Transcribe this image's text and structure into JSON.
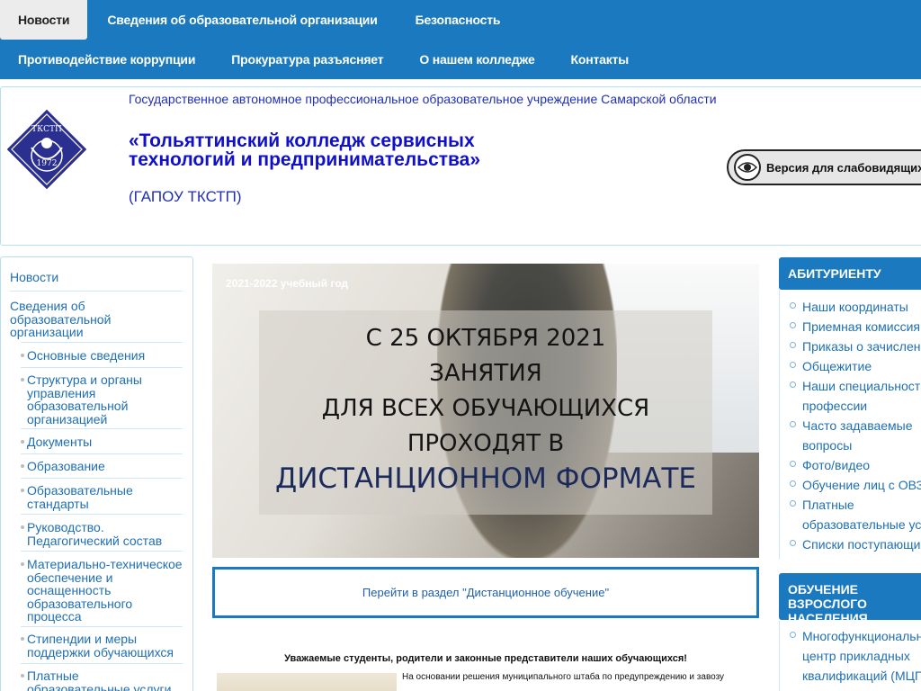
{
  "nav": {
    "row1": [
      "Новости",
      "Сведения об образовательной организации",
      "Безопасность"
    ],
    "row2": [
      "Противодействие коррупции",
      "Прокуратура разъясняет",
      "О нашем колледже",
      "Контакты"
    ]
  },
  "header": {
    "subtitle": "Государственное автономное профессиональное образовательное учреждение Самарской области",
    "title_line1": "«Тольяттинский колледж сервисных",
    "title_line2": "технологий и предпринимательства»",
    "abbr": "(ГАПОУ ТКСТП)",
    "logo_text_top": "ТКСТП",
    "logo_text_bottom": "1972",
    "vi_button": "Версия для слабовидящих"
  },
  "left_menu": {
    "news": "Новости",
    "org_info": "Сведения об образовательной организации",
    "subitems": [
      "Основные сведения",
      "Структура и органы управления образовательной организацией",
      "Документы",
      "Образование",
      "Образовательные стандарты",
      "Руководство. Педагогический состав",
      "Материально-техническое обеспечение и оснащенность образовательного процесса",
      "Стипендии и меры поддержки обучающихся",
      "Платные образовательные услуги"
    ]
  },
  "banner": {
    "year": "2021-2022 учебный год",
    "line1": "С 25 ОКТЯБРЯ 2021",
    "line2": "ЗАНЯТИЯ",
    "line3": "ДЛЯ ВСЕХ ОБУЧАЮЩИХСЯ",
    "line4": "ПРОХОДЯТ В",
    "line5": "ДИСТАНЦИОННОМ ФОРМАТЕ"
  },
  "distance_link": "Перейти в раздел \"Дистанционное обучение\"",
  "notice": {
    "heading": "Уважаемые студенты, родители и законные представители наших обучающихся!",
    "body": "На основании решения муниципального штаба по предупреждению и завозу"
  },
  "right": {
    "abit_title": "АБИТУРИЕНТУ",
    "abit_items": [
      "Наши координаты",
      "Приемная комиссия",
      "Приказы о зачислении",
      "Общежитие",
      "Наши специальности,",
      "профессии",
      "Часто задаваемые",
      "вопросы",
      "Фото/видео",
      "Обучение лиц с ОВЗ",
      "Платные",
      "образовательные услуги",
      "Списки поступающих"
    ],
    "adult_title": "ОБУЧЕНИЕ ВЗРОСЛОГО НАСЕЛЕНИЯ",
    "adult_items": [
      "Многофункциональный",
      "центр прикладных",
      "квалификаций (МЦПК)"
    ]
  }
}
